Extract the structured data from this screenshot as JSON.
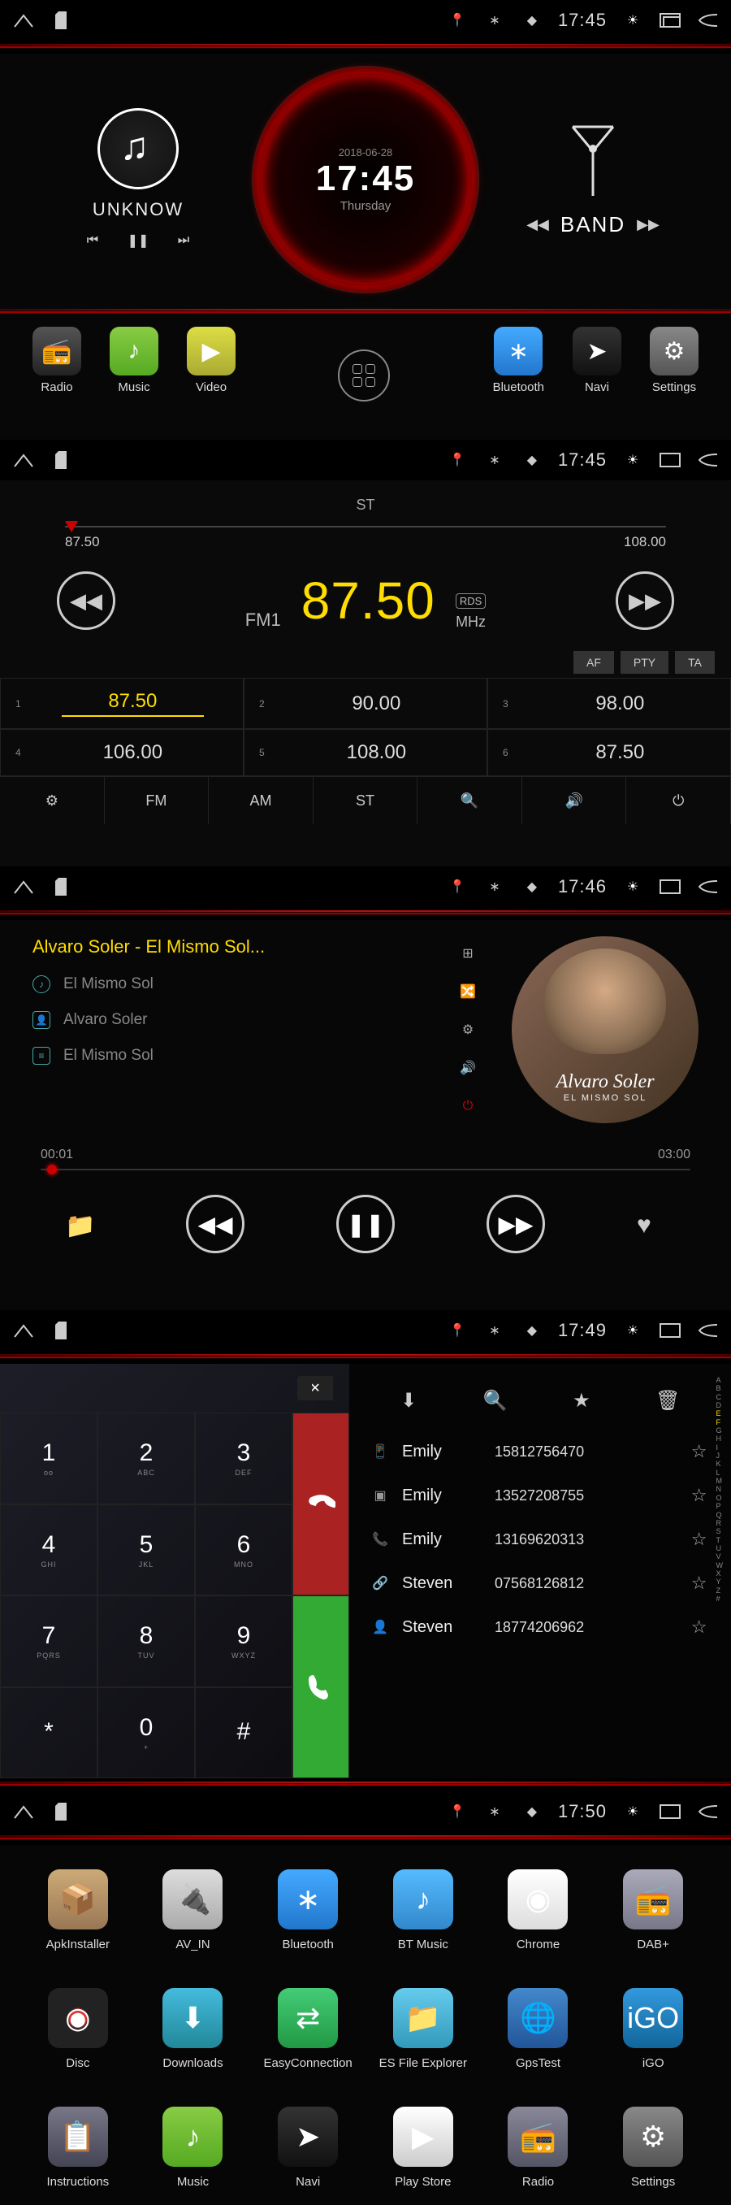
{
  "status": {
    "time1": "17:45",
    "time2": "17:45",
    "time3": "17:46",
    "time4": "17:49",
    "time5": "17:50"
  },
  "home": {
    "music_title": "UNKNOW",
    "gauge": {
      "date": "2018-06-28",
      "time": "17:45",
      "day": "Thursday"
    },
    "band_label": "BAND",
    "dock": [
      {
        "label": "Radio",
        "cls": "ic-radio",
        "g": "📻"
      },
      {
        "label": "Music",
        "cls": "ic-music",
        "g": "♪"
      },
      {
        "label": "Video",
        "cls": "ic-video",
        "g": "▶"
      },
      {
        "label": "Bluetooth",
        "cls": "ic-bt",
        "g": "∗"
      },
      {
        "label": "Navi",
        "cls": "ic-navi",
        "g": "➤"
      },
      {
        "label": "Settings",
        "cls": "ic-settings",
        "g": "⚙"
      }
    ]
  },
  "radio": {
    "st": "ST",
    "min": "87.50",
    "max": "108.00",
    "fm": "FM1",
    "freq": "87.50",
    "unit": "MHz",
    "rds": "RDS",
    "tags": [
      "AF",
      "PTY",
      "TA"
    ],
    "presets": [
      {
        "n": "1",
        "v": "87.50",
        "active": true
      },
      {
        "n": "2",
        "v": "90.00"
      },
      {
        "n": "3",
        "v": "98.00"
      },
      {
        "n": "4",
        "v": "106.00"
      },
      {
        "n": "5",
        "v": "108.00"
      },
      {
        "n": "6",
        "v": "87.50"
      }
    ],
    "bottom": [
      "⚙",
      "FM",
      "AM",
      "ST",
      "🔍",
      "🔊",
      "⏻"
    ]
  },
  "player": {
    "title": "Alvaro Soler - El Mismo Sol...",
    "track": "El Mismo Sol",
    "artist": "Alvaro Soler",
    "album": "El Mismo Sol",
    "album_name": "Alvaro Soler",
    "album_sub": "EL MISMO SOL",
    "elapsed": "00:01",
    "total": "03:00"
  },
  "phone": {
    "keys": [
      {
        "n": "1",
        "s": "ᴏᴏ"
      },
      {
        "n": "2",
        "s": "ABC"
      },
      {
        "n": "3",
        "s": "DEF"
      },
      {
        "n": "4",
        "s": "GHI"
      },
      {
        "n": "5",
        "s": "JKL"
      },
      {
        "n": "6",
        "s": "MNO"
      },
      {
        "n": "7",
        "s": "PQRS"
      },
      {
        "n": "8",
        "s": "TUV"
      },
      {
        "n": "9",
        "s": "WXYZ"
      },
      {
        "n": "*",
        "s": ""
      },
      {
        "n": "0",
        "s": "+"
      },
      {
        "n": "#",
        "s": ""
      }
    ],
    "contacts": [
      {
        "type": "📱",
        "name": "Emily",
        "phone": "15812756470"
      },
      {
        "type": "▣",
        "name": "Emily",
        "phone": "13527208755"
      },
      {
        "type": "📞",
        "name": "Emily",
        "phone": "13169620313"
      },
      {
        "type": "🔗",
        "name": "Steven",
        "phone": "07568126812"
      },
      {
        "type": "👤",
        "name": "Steven",
        "phone": "18774206962"
      }
    ],
    "alpha": [
      "A",
      "B",
      "C",
      "D",
      "E",
      "F",
      "G",
      "H",
      "I",
      "J",
      "K",
      "L",
      "M",
      "N",
      "O",
      "P",
      "Q",
      "R",
      "S",
      "T",
      "U",
      "V",
      "W",
      "X",
      "Y",
      "Z",
      "#"
    ]
  },
  "drawer": {
    "apps": [
      {
        "label": "ApkInstaller",
        "cls": "ic-box",
        "g": "📦"
      },
      {
        "label": "AV_IN",
        "cls": "ic-avin",
        "g": "🔌"
      },
      {
        "label": "Bluetooth",
        "cls": "ic-bt",
        "g": "∗"
      },
      {
        "label": "BT Music",
        "cls": "ic-btm",
        "g": "♪"
      },
      {
        "label": "Chrome",
        "cls": "ic-chrome",
        "g": "◉"
      },
      {
        "label": "DAB+",
        "cls": "ic-dab",
        "g": "📻"
      },
      {
        "label": "Disc",
        "cls": "ic-disc",
        "g": "◉"
      },
      {
        "label": "Downloads",
        "cls": "ic-dl",
        "g": "⬇"
      },
      {
        "label": "EasyConnection",
        "cls": "ic-ec",
        "g": "⇄"
      },
      {
        "label": "ES File Explorer",
        "cls": "ic-es",
        "g": "📁"
      },
      {
        "label": "GpsTest",
        "cls": "ic-gps",
        "g": "🌐"
      },
      {
        "label": "iGO",
        "cls": "ic-igo",
        "g": "iGO"
      },
      {
        "label": "Instructions",
        "cls": "ic-inst",
        "g": "📋"
      },
      {
        "label": "Music",
        "cls": "ic-music",
        "g": "♪"
      },
      {
        "label": "Navi",
        "cls": "ic-navi",
        "g": "➤"
      },
      {
        "label": "Play Store",
        "cls": "ic-ps",
        "g": "▶"
      },
      {
        "label": "Radio",
        "cls": "ic-rad",
        "g": "📻"
      },
      {
        "label": "Settings",
        "cls": "ic-settings",
        "g": "⚙"
      }
    ]
  }
}
